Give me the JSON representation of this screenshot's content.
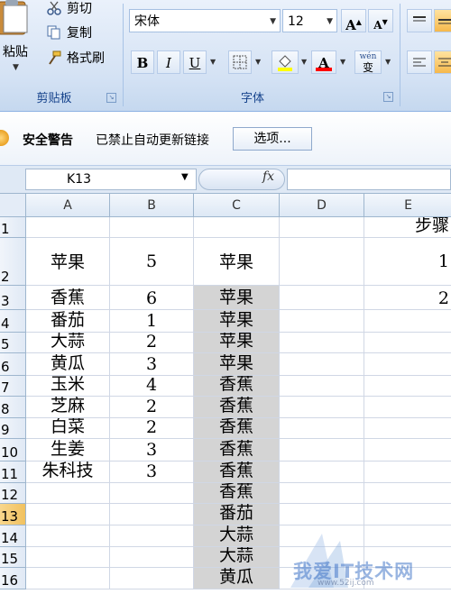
{
  "ribbon": {
    "clipboard": {
      "paste_label": "粘贴",
      "cut_label": "剪切",
      "copy_label": "复制",
      "format_painter_label": "格式刷",
      "group_label": "剪贴板"
    },
    "font": {
      "font_name": "宋体",
      "font_size": "12",
      "grow_label": "A",
      "shrink_label": "A",
      "bold_label": "B",
      "italic_label": "I",
      "underline_label": "U",
      "fill_label": "",
      "color_label": "A",
      "wen_label": "wén",
      "wen_char": "变",
      "group_label": "字体"
    }
  },
  "security": {
    "title": "安全警告",
    "message": "已禁止自动更新链接",
    "options_label": "选项..."
  },
  "formula_bar": {
    "name_box": "K13",
    "fx_label": "fx",
    "formula": ""
  },
  "sheet": {
    "columns": [
      "A",
      "B",
      "C",
      "D",
      "E"
    ],
    "rows": [
      {
        "num": "1",
        "A": "",
        "B": "",
        "C": "",
        "D": "",
        "E": "步骤"
      },
      {
        "num": "2",
        "A": "苹果",
        "B": "5",
        "C": "苹果",
        "D": "",
        "E": "1"
      },
      {
        "num": "3",
        "A": "香蕉",
        "B": "6",
        "C": "苹果",
        "D": "",
        "E": "2"
      },
      {
        "num": "4",
        "A": "番茄",
        "B": "1",
        "C": "苹果",
        "D": "",
        "E": ""
      },
      {
        "num": "5",
        "A": "大蒜",
        "B": "2",
        "C": "苹果",
        "D": "",
        "E": ""
      },
      {
        "num": "6",
        "A": "黄瓜",
        "B": "3",
        "C": "苹果",
        "D": "",
        "E": ""
      },
      {
        "num": "7",
        "A": "玉米",
        "B": "4",
        "C": "香蕉",
        "D": "",
        "E": ""
      },
      {
        "num": "8",
        "A": "芝麻",
        "B": "2",
        "C": "香蕉",
        "D": "",
        "E": ""
      },
      {
        "num": "9",
        "A": "白菜",
        "B": "2",
        "C": "香蕉",
        "D": "",
        "E": ""
      },
      {
        "num": "10",
        "A": "生姜",
        "B": "3",
        "C": "香蕉",
        "D": "",
        "E": ""
      },
      {
        "num": "11",
        "A": "朱科技",
        "B": "3",
        "C": "香蕉",
        "D": "",
        "E": ""
      },
      {
        "num": "12",
        "A": "",
        "B": "",
        "C": "香蕉",
        "D": "",
        "E": ""
      },
      {
        "num": "13",
        "A": "",
        "B": "",
        "C": "番茄",
        "D": "",
        "E": ""
      },
      {
        "num": "14",
        "A": "",
        "B": "",
        "C": "大蒜",
        "D": "",
        "E": ""
      },
      {
        "num": "15",
        "A": "",
        "B": "",
        "C": "大蒜",
        "D": "",
        "E": ""
      },
      {
        "num": "16",
        "A": "",
        "B": "",
        "C": "黄瓜",
        "D": "",
        "E": ""
      }
    ]
  },
  "watermark": {
    "text": "我爱IT技术网",
    "url": "www.52ij.com"
  },
  "colors": {
    "selected_row_header": "#f1c15f",
    "gray_fill": "#d4d4d4",
    "ribbon_label": "#15428b"
  }
}
